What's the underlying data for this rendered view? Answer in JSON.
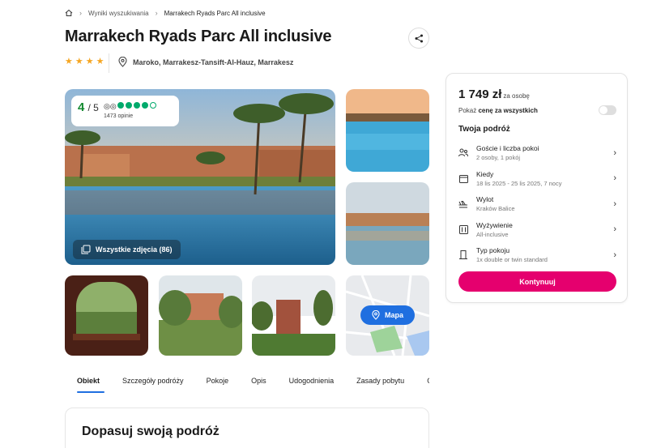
{
  "breadcrumb": {
    "home_icon": "home-icon",
    "search_results": "Wyniki wyszukiwania",
    "current": "Marrakech Ryads Parc All inclusive"
  },
  "hotel": {
    "name": "Marrakech Ryads Parc All inclusive",
    "stars": 4,
    "location": "Maroko, Marrakesz-Tansift-Al-Hauz, Marrakesz"
  },
  "rating": {
    "score": "4",
    "of": "/ 5",
    "bubbles_filled": 4,
    "bubbles_total": 5,
    "opinions": "1473 opinie"
  },
  "gallery": {
    "all_photos": "Wszystkie zdjęcia (86)",
    "map_label": "Mapa"
  },
  "tabs": [
    "Obiekt",
    "Szczegóły podróży",
    "Pokoje",
    "Opis",
    "Udogodnienia",
    "Zasady pobytu",
    "O"
  ],
  "fit_section": {
    "title": "Dopasuj swoją podróż"
  },
  "booking": {
    "price": "1 749 zł",
    "price_unit": "za osobę",
    "toggle_prefix": "Pokaż",
    "toggle_bold": "cenę za wszystkich",
    "toggle_on": false,
    "trip_title": "Twoja podróż",
    "rows": [
      {
        "icon": "guests-icon",
        "label": "Goście i liczba pokoi",
        "value": "2 osoby, 1 pokój"
      },
      {
        "icon": "calendar-icon",
        "label": "Kiedy",
        "value": "18 lis 2025 - 25 lis 2025, 7 nocy"
      },
      {
        "icon": "plane-icon",
        "label": "Wylot",
        "value": "Kraków Balice"
      },
      {
        "icon": "food-icon",
        "label": "Wyżywienie",
        "value": "All-inclusive"
      },
      {
        "icon": "door-icon",
        "label": "Typ pokoju",
        "value": "1x double or twin standard"
      }
    ],
    "cta": "Kontynuuj"
  },
  "colors": {
    "accent": "#e5006e",
    "link_blue": "#1f6fe0",
    "star": "#f5a623",
    "rating_green": "#00aa6c"
  }
}
